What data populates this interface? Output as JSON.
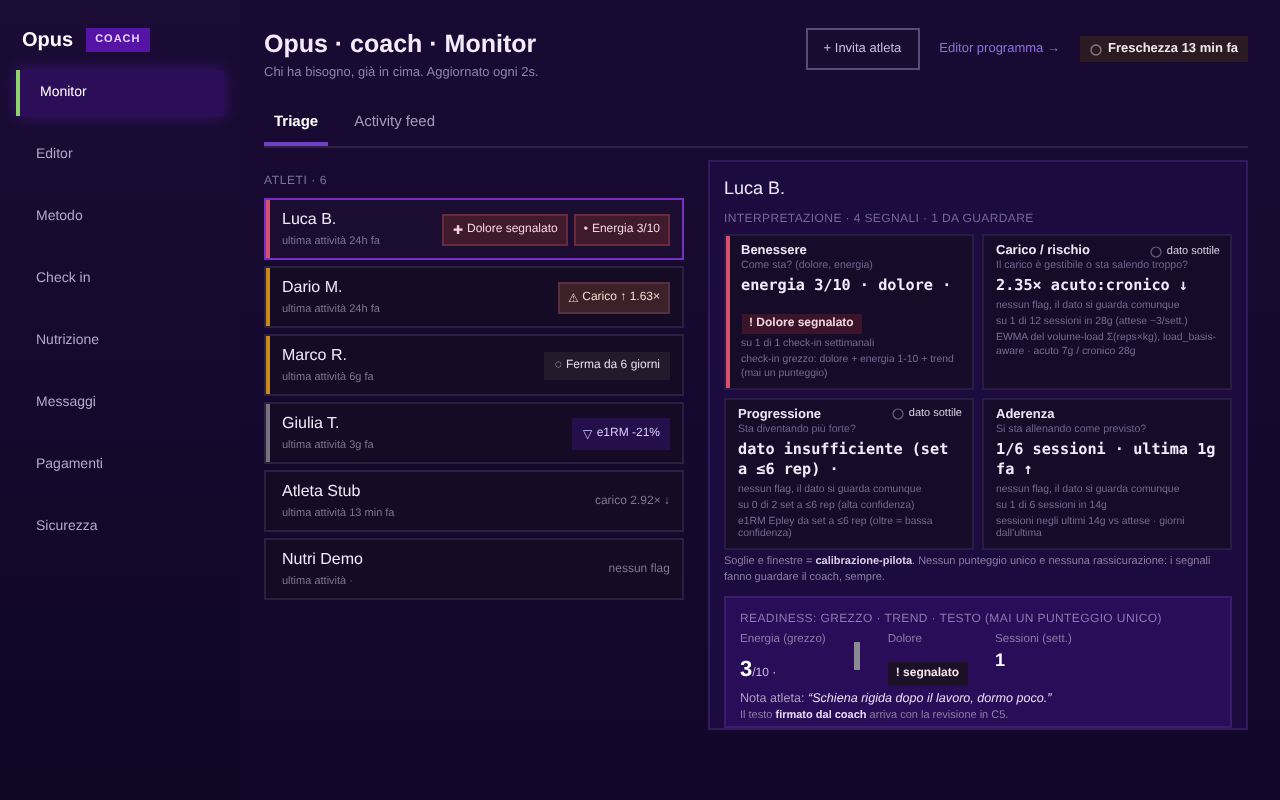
{
  "brand": {
    "name": "Opus",
    "badge": "COACH"
  },
  "sidebar": {
    "items": [
      {
        "label": "Monitor",
        "selected": true
      },
      {
        "label": "Editor",
        "selected": false
      },
      {
        "label": "Metodo",
        "selected": false
      },
      {
        "label": "Check in",
        "selected": false
      },
      {
        "label": "Nutrizione",
        "selected": false
      },
      {
        "label": "Messaggi",
        "selected": false
      },
      {
        "label": "Pagamenti",
        "selected": false
      },
      {
        "label": "Sicurezza",
        "selected": false
      }
    ]
  },
  "header": {
    "title": "Opus · coach · Monitor",
    "subtitle": "Chi ha bisogno, già in cima. Aggiornato ogni 2s.",
    "invite_button": "+ Invita atleta",
    "editor_link": "Editor programma →",
    "freshness": "Freschezza 13 min fa"
  },
  "tabs": [
    {
      "label": "Triage",
      "selected": true
    },
    {
      "label": "Activity feed",
      "selected": false
    }
  ],
  "athletes": {
    "heading": "ATLETI · 6",
    "rows": [
      {
        "name": "Luca B.",
        "activity": "ultima attività 24h fa",
        "selected": true,
        "color": "#d9506e",
        "flags": [
          {
            "kind": "danger",
            "icon": "✚",
            "label": "Dolore segnalato"
          },
          {
            "kind": "danger",
            "icon": "•",
            "label": "Energia 3/10"
          }
        ]
      },
      {
        "name": "Dario M.",
        "activity": "ultima attività 24h fa",
        "selected": false,
        "color": "#c8891e",
        "flags": [
          {
            "kind": "warn",
            "icon": "⚠",
            "label": "Carico ↑ 1.63×"
          }
        ]
      },
      {
        "name": "Marco R.",
        "activity": "ultima attività 6g fa",
        "selected": false,
        "color": "#c8891e",
        "flags": [
          {
            "kind": "neutral",
            "icon": "◌",
            "label": "Ferma da 6 giorni"
          }
        ]
      },
      {
        "name": "Giulia T.",
        "activity": "ultima attività 3g fa",
        "selected": false,
        "color": "#77737f",
        "flags": [
          {
            "kind": "info",
            "icon": "▽",
            "label": "e1RM -21%"
          }
        ]
      },
      {
        "name": "Atleta Stub",
        "activity": "ultima attività 13 min fa",
        "selected": false,
        "flags": [
          {
            "kind": "note",
            "label": "carico 2.92× ↓"
          }
        ]
      },
      {
        "name": "Nutri Demo",
        "activity": "ultima attività ·",
        "selected": false,
        "flags": [
          {
            "kind": "note",
            "label": "nessun flag"
          }
        ]
      }
    ]
  },
  "detail": {
    "title": "Luca B.",
    "heading": "INTERPRETAZIONE · 4 SEGNALI · 1 DA GUARDARE",
    "cards": [
      {
        "title": "Benessere",
        "alert": true,
        "question": "Come sta? (dolore, energia)",
        "value": "energia 3/10 · dolore ·",
        "flag": "! Dolore segnalato",
        "lines": [
          "su 1 di 1 check-in settimanali",
          "check-in grezzo: dolore + energia 1-10 + trend (mai un punteggio)"
        ]
      },
      {
        "title": "Carico / rischio",
        "alert": false,
        "badge": "dato sottile",
        "question": "Il carico è gestibile o sta salendo troppo?",
        "value": "2.35× acuto:cronico ↓",
        "lines": [
          "nessun flag, il dato si guarda comunque",
          "su 1 di 12 sessioni in 28g (attese ~3/sett.)",
          "EWMA del volume-load Σ(reps×kg), load_basis-aware · acuto 7g / cronico 28g"
        ]
      },
      {
        "title": "Progressione",
        "alert": false,
        "badge": "dato sottile",
        "question": "Sta diventando più forte?",
        "value": "dato insufficiente (set a ≤6 rep) ·",
        "lines": [
          "nessun flag, il dato si guarda comunque",
          "su 0 di 2 set a ≤6 rep (alta confidenza)",
          "e1RM Epley da set a ≤6 rep (oltre = bassa confidenza)"
        ]
      },
      {
        "title": "Aderenza",
        "alert": false,
        "question": "Si sta allenando come previsto?",
        "value": "1/6 sessioni · ultima 1g fa ↑",
        "lines": [
          "nessun flag, il dato si guarda comunque",
          "su 1 di 6 sessioni in 14g",
          "sessioni negli ultimi 14g vs attese · giorni dall'ultima"
        ]
      }
    ],
    "footnote": "Soglie e finestre = **calibrazione-pilota**. Nessun punteggio unico e nessuna rassicurazione: i segnali fanno guardare il coach, sempre.",
    "readiness": {
      "heading": "READINESS: GREZZO · TREND · TESTO (MAI UN PUNTEGGIO UNICO)",
      "energy": {
        "label": "Energia (grezzo)",
        "value": "3",
        "unit": "/10",
        "mark": "·"
      },
      "pain": {
        "label": "Dolore",
        "badge": "! segnalato"
      },
      "sessions": {
        "label": "Sessioni (sett.)",
        "value": "1"
      },
      "note_label": "Nota atleta:",
      "note": "“Schiena rigida dopo il lavoro, dormo poco.”",
      "footer": "Il testo **firmato dal coach** arriva con la revisione in C5."
    }
  }
}
